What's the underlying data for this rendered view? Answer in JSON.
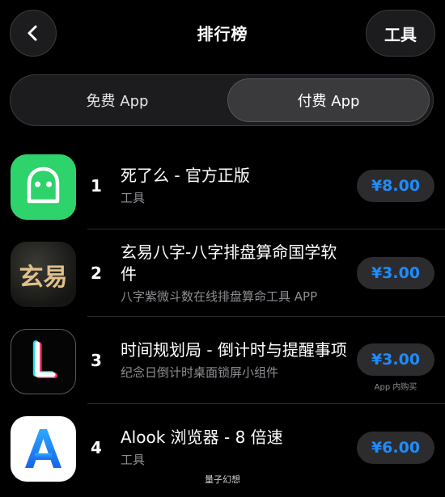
{
  "header": {
    "title": "排行榜",
    "tools_label": "工具"
  },
  "segment": {
    "tabs": [
      {
        "label": "免费 App",
        "selected": false
      },
      {
        "label": "付费 App",
        "selected": true
      }
    ]
  },
  "apps": [
    {
      "rank": "1",
      "name": "死了么 - 官方正版",
      "subtitle": "工具",
      "price": "¥8.00",
      "iap": "",
      "icon": "ghost-icon"
    },
    {
      "rank": "2",
      "name": "玄易八字-八字排盘算命国学软件",
      "subtitle": "八字紫微斗数在线排盘算命工具 APP",
      "price": "¥3.00",
      "iap": "",
      "icon": "xuanyi-logo",
      "icon_text": "玄易"
    },
    {
      "rank": "3",
      "name": "时间规划局 - 倒计时与提醒事项",
      "subtitle": "纪念日倒计时桌面锁屏小组件",
      "price": "¥3.00",
      "iap": "App 内购买",
      "icon": "clock-hands-icon"
    },
    {
      "rank": "4",
      "name": "Alook 浏览器 - 8 倍速",
      "subtitle": "工具",
      "price": "¥6.00",
      "iap": "",
      "icon": "alook-a-icon"
    }
  ],
  "watermark": "量子幻想",
  "colors": {
    "price_blue": "#1e8cff",
    "ghost_green": "#2fd36b",
    "background": "#000000"
  }
}
